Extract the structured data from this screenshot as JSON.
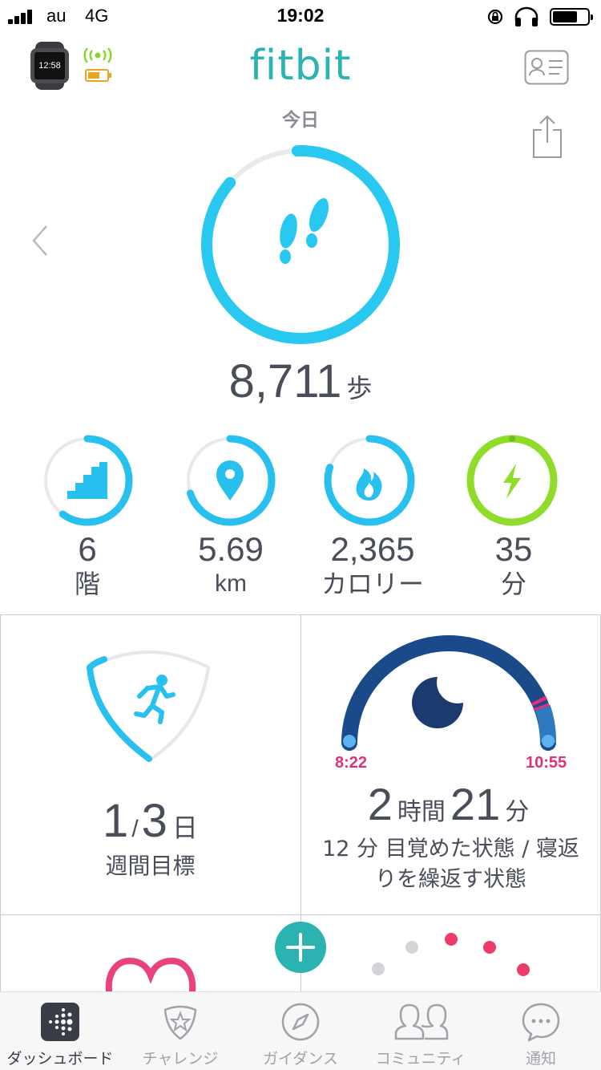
{
  "status_bar": {
    "carrier": "au",
    "network": "4G",
    "time": "19:02"
  },
  "header": {
    "logo": "fitbit",
    "date_label": "今日",
    "device_icon": "smartwatch-icon",
    "sync_icon": "sync-signal-icon",
    "battery_icon": "device-battery-icon",
    "profile_icon": "profile-card-icon",
    "share_icon": "share-icon",
    "prev_icon": "chevron-left-icon"
  },
  "steps": {
    "value": "8,711",
    "unit": "歩",
    "progress": 0.87,
    "icon": "footprints-icon",
    "color": "#28c8f0"
  },
  "stats": [
    {
      "key": "floors",
      "value": "6",
      "unit": "階",
      "icon": "stairs-icon",
      "progress": 0.6,
      "color": "#28c0ef"
    },
    {
      "key": "distance",
      "value": "5.69",
      "unit": "km",
      "icon": "location-pin-icon",
      "progress": 0.7,
      "color": "#28c0ef"
    },
    {
      "key": "calories",
      "value": "2,365",
      "unit": "カロリー",
      "icon": "flame-icon",
      "progress": 0.8,
      "color": "#28c0ef"
    },
    {
      "key": "active_minutes",
      "value": "35",
      "unit": "分",
      "icon": "lightning-icon",
      "progress": 1.0,
      "color": "#8fdc2a"
    }
  ],
  "exercise_goal": {
    "done": "1",
    "total": "3",
    "unit": "日",
    "label": "週間目標",
    "icon": "runner-icon",
    "progress": 0.33
  },
  "sleep": {
    "start": "8:22",
    "end": "10:55",
    "hours": "2",
    "hours_unit": "時間",
    "minutes": "21",
    "minutes_unit": "分",
    "note": "12 分 目覚めた状態 / 寝返りを繰返す状態",
    "icon": "moon-icon",
    "arc_color": "#1a4a8a",
    "accent_color": "#e0307a"
  },
  "add_button": {
    "icon": "plus-icon"
  },
  "tabs": [
    {
      "label": "ダッシュボード",
      "icon": "dashboard-icon"
    },
    {
      "label": "チャレンジ",
      "icon": "challenge-star-icon"
    },
    {
      "label": "ガイダンス",
      "icon": "compass-icon"
    },
    {
      "label": "コミュニティ",
      "icon": "community-icon"
    },
    {
      "label": "通知",
      "icon": "chat-bubble-icon"
    }
  ]
}
